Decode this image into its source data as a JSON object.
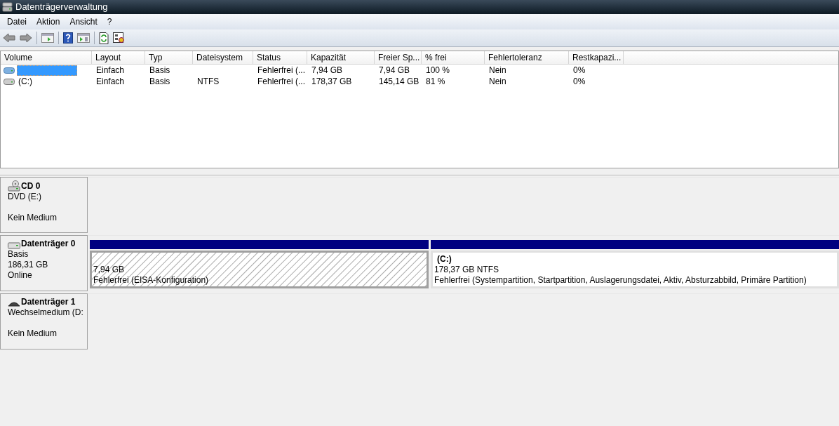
{
  "window": {
    "title": "Datenträgerverwaltung"
  },
  "menu": [
    "Datei",
    "Aktion",
    "Ansicht",
    "?"
  ],
  "table": {
    "columns": [
      "Volume",
      "Layout",
      "Typ",
      "Dateisystem",
      "Status",
      "Kapazität",
      "Freier Sp...",
      "% frei",
      "Fehlertoleranz",
      "Restkapazi..."
    ],
    "rows": [
      {
        "selected": true,
        "cells": [
          "",
          "Einfach",
          "Basis",
          "",
          "Fehlerfrei (...",
          "7,94 GB",
          "7,94 GB",
          "100 %",
          "Nein",
          "0%"
        ]
      },
      {
        "selected": false,
        "cells": [
          "(C:)",
          "Einfach",
          "Basis",
          "NTFS",
          "Fehlerfrei (...",
          "178,37 GB",
          "145,14 GB",
          "81 %",
          "Nein",
          "0%"
        ]
      }
    ]
  },
  "disks": [
    {
      "kind": "cd",
      "name": "CD 0",
      "details": [
        "DVD (E:)"
      ],
      "status": "Kein Medium"
    },
    {
      "kind": "hdd",
      "name": "Datenträger 0",
      "details": [
        "Basis",
        "186,31 GB"
      ],
      "status": "Online",
      "partitions": [
        {
          "kind": "hatched",
          "size": "7,94 GB",
          "status": "Fehlerfrei (EISA-Konfiguration)"
        },
        {
          "kind": "primary",
          "label": "(C:)",
          "size": "178,37 GB NTFS",
          "status": "Fehlerfrei (Systempartition, Startpartition, Auslagerungsdatei, Aktiv, Absturzabbild, Primäre Partition)"
        }
      ]
    },
    {
      "kind": "removable",
      "name": "Datenträger 1",
      "details": [
        "Wechselmedium (D:"
      ],
      "status": "Kein Medium"
    }
  ]
}
